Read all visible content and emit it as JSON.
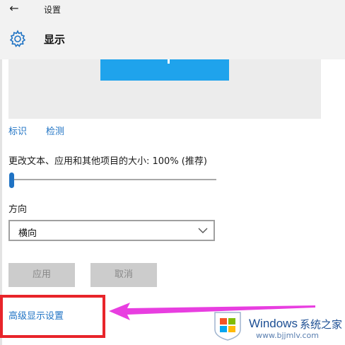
{
  "window": {
    "title": "设置",
    "back_icon": "arrow-left-icon"
  },
  "header": {
    "title": "显示",
    "icon": "gear-icon"
  },
  "preview": {
    "accent": "#1fa3ec"
  },
  "links": {
    "identify": "标识",
    "detect": "检测"
  },
  "scale": {
    "label": "更改文本、应用和其他项目的大小: 100% (推荐)",
    "value_fraction": 0.0
  },
  "orientation": {
    "label": "方向",
    "selected": "横向"
  },
  "buttons": {
    "apply": "应用",
    "cancel": "取消"
  },
  "advanced": {
    "label": "高级显示设置"
  },
  "annotation": {
    "box_color": "#e8242a",
    "arrow_color": "#e83ee0"
  },
  "watermark": {
    "brand": "Windows",
    "site_name": "系统之家",
    "url": "www.bjjmlv.com"
  }
}
